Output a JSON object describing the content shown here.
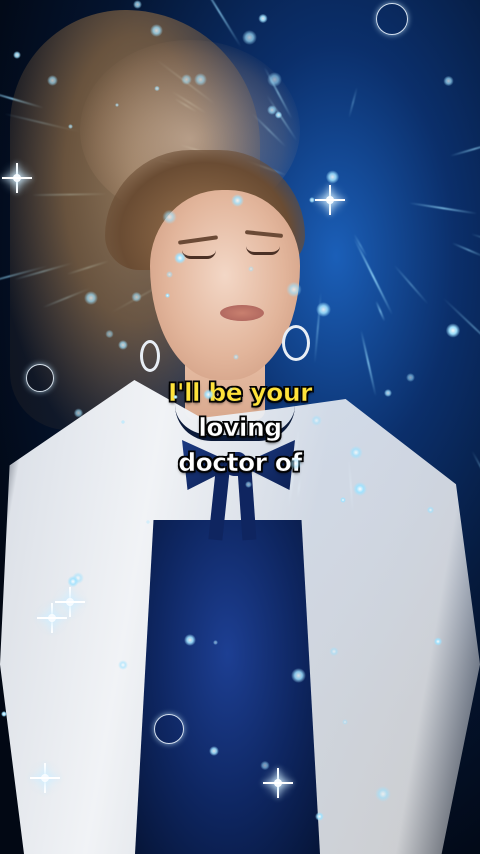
{
  "video": {
    "caption_lines": [
      "I'll be your",
      "loving",
      "doctor of"
    ],
    "highlighted_line_index": 0,
    "colors": {
      "caption_text": "#ffffff",
      "caption_highlight": "#ffe33a",
      "background_glow": "#1b5fb8",
      "shirt": "#f1f3f6",
      "top": "#0e2661"
    }
  }
}
